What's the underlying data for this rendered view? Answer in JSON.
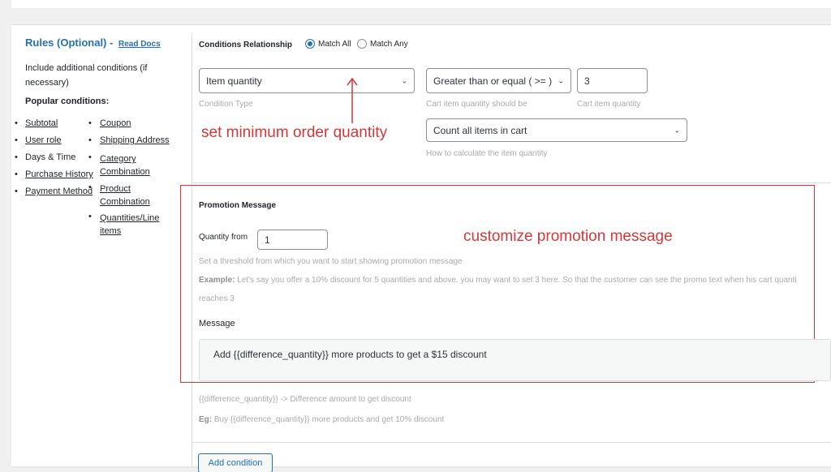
{
  "rules": {
    "title": "Rules (Optional) -",
    "read_docs": "Read Docs",
    "description": "Include additional conditions (if necessary)",
    "popular_heading": "Popular conditions:",
    "col1": [
      "Subtotal",
      "User role",
      "Days & Time",
      "Purchase History",
      "Payment Method"
    ],
    "col2": [
      "Coupon",
      "Shipping Address",
      "Category Combination",
      "Product Combination",
      "Quantities/Line items"
    ]
  },
  "conditions": {
    "relationship_label": "Conditions Relationship",
    "match_all": "Match All",
    "match_any": "Match Any",
    "condition_type_value": "Item quantity",
    "condition_type_caption": "Condition Type",
    "operator_value": "Greater than or equal ( >= )",
    "operator_caption": "Cart item quantity should be",
    "quantity_value": "3",
    "quantity_caption": "Cart item quantity",
    "count_mode_value": "Count all items in cart",
    "count_mode_caption": "How to calculate the item quantity"
  },
  "annotations": {
    "min_order": "set minimum order quantity",
    "promo": "customize promotion message",
    "color": "#d63638"
  },
  "promotion": {
    "heading": "Promotion Message",
    "quantity_from_label": "Quantity from",
    "quantity_from_value": "1",
    "threshold_help": "Set a threshold from which you want to start showing promotion message",
    "example_label": "Example:",
    "example_text": "Let's say you offer a 10% discount for 5 quantities and above. you may want to set 3 here. So that the customer can see the promo text when his cart quanti",
    "example_cont": "reaches 3",
    "message_label": "Message",
    "message_value": "Add {{difference_quantity}} more products to get a $15 discount",
    "hint1": "{{difference_quantity}} -> Difference amount to get discount",
    "hint2_label": "Eg:",
    "hint2_text": "Buy {{difference_quantity}} more products and get 10% discount"
  },
  "footer": {
    "add_condition": "Add condition"
  },
  "colors": {
    "accent": "#2271b1",
    "annotation": "#d63638"
  }
}
